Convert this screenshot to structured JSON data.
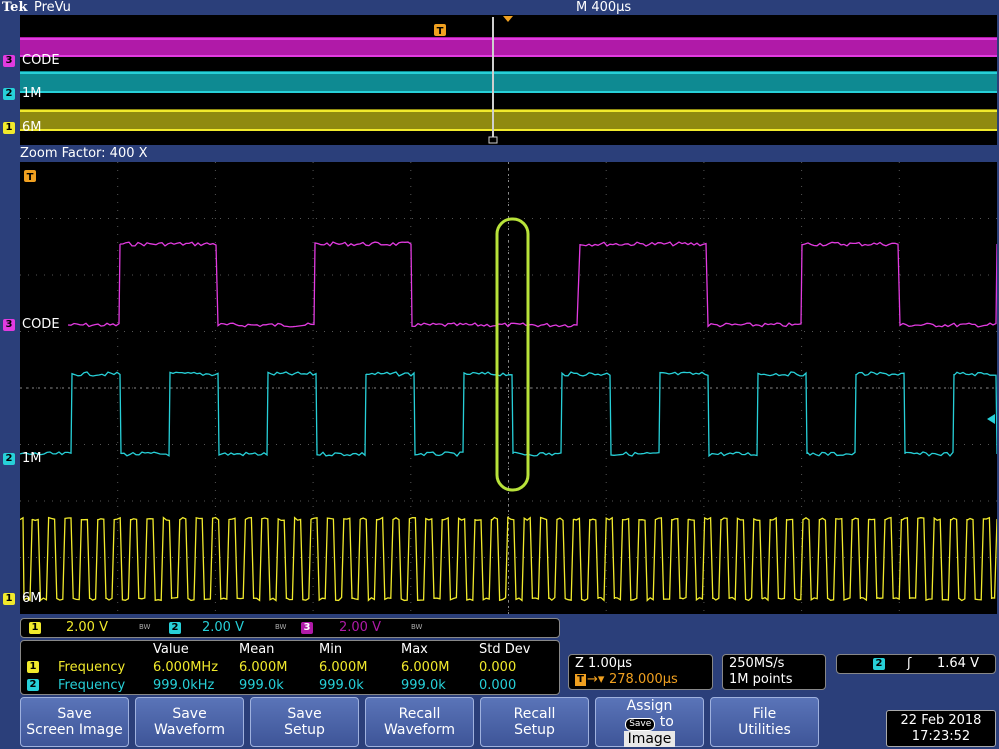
{
  "header": {
    "logo": "Tek",
    "mode": "PreVu",
    "timebase": "M 400µs"
  },
  "zoom_factor": "Zoom Factor: 400 X",
  "trigger_marker": "T",
  "channels": [
    {
      "num": "3",
      "label": "CODE",
      "color": "#e23be0"
    },
    {
      "num": "2",
      "label": "1M",
      "color": "#27d0d8"
    },
    {
      "num": "1",
      "label": "6M",
      "color": "#f1ea2c"
    }
  ],
  "vertical_scales": [
    {
      "num": "1",
      "value": "2.00 V",
      "bw": "BW"
    },
    {
      "num": "2",
      "value": "2.00 V",
      "bw": "BW"
    },
    {
      "num": "3",
      "value": "2.00 V",
      "bw": "BW"
    }
  ],
  "measurements": {
    "headers": [
      "Value",
      "Mean",
      "Min",
      "Max",
      "Std Dev"
    ],
    "rows": [
      {
        "ch": "1",
        "name": "Frequency",
        "value": "6.000MHz",
        "mean": "6.000M",
        "min": "6.000M",
        "max": "6.000M",
        "std": "0.000"
      },
      {
        "ch": "2",
        "name": "Frequency",
        "value": "999.0kHz",
        "mean": "999.0k",
        "min": "999.0k",
        "max": "999.0k",
        "std": "0.000"
      }
    ]
  },
  "zoom_info": {
    "zoom": "Z 1.00µs",
    "position": "278.000µs",
    "t_icon": "T"
  },
  "sample": {
    "rate": "250MS/s",
    "points": "1M points"
  },
  "trigger": {
    "ch": "2",
    "slope": "ʃ",
    "level": "1.64 V"
  },
  "buttons": [
    {
      "line1": "Save",
      "line2": "Screen Image"
    },
    {
      "line1": "Save",
      "line2": "Waveform"
    },
    {
      "line1": "Save",
      "line2": "Setup"
    },
    {
      "line1": "Recall",
      "line2": "Waveform"
    },
    {
      "line1": "Recall",
      "line2": "Setup"
    },
    {
      "line1": "Assign",
      "badge": "Save",
      "line2": "to",
      "line3": "Image"
    },
    {
      "line1": "File",
      "line2": "Utilities"
    }
  ],
  "datetime": {
    "date": "22 Feb  2018",
    "time": "17:23:52"
  },
  "colors": {
    "magenta": "#e23be0",
    "cyan": "#27d0d8",
    "yellow": "#f1ea2c",
    "highlight": "#b8e23a",
    "orange": "#f0a020"
  }
}
